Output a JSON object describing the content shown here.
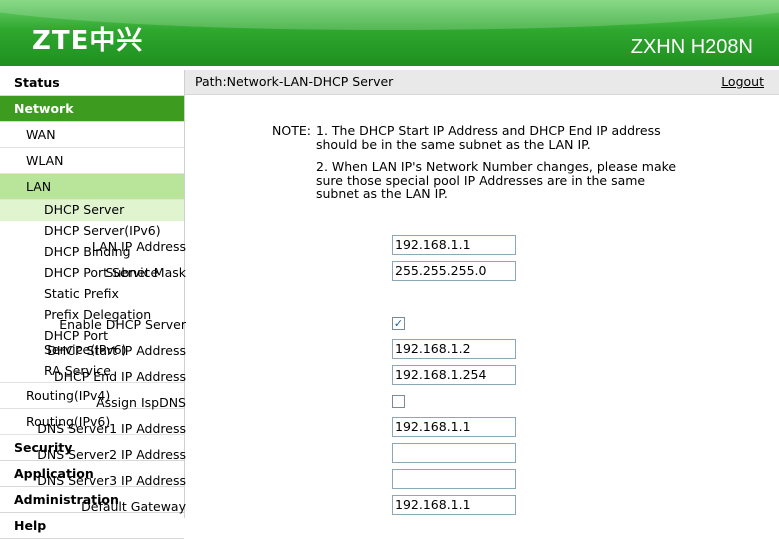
{
  "header": {
    "logo": "ZTE中兴",
    "model": "ZXHN H208N"
  },
  "sidebar": {
    "status": "Status",
    "network": "Network",
    "wan": "WAN",
    "wlan": "WLAN",
    "lan": "LAN",
    "lan_items": [
      "DHCP Server",
      "DHCP Server(IPv6)",
      "DHCP Binding",
      "DHCP Port Service",
      "Static Prefix",
      "Prefix Delegation",
      "DHCP Port Service(IPv6)",
      "RA Service"
    ],
    "routing_ipv4": "Routing(IPv4)",
    "routing_ipv6": "Routing(IPv6)",
    "security": "Security",
    "application": "Application",
    "administration": "Administration",
    "help": "Help"
  },
  "pathbar": {
    "path": "Path:Network-LAN-DHCP Server",
    "logout": "Logout"
  },
  "note": {
    "label": "NOTE:",
    "line1": "1. The DHCP Start IP Address and DHCP End IP address should be in the same subnet as the LAN IP.",
    "line2": "2. When LAN IP's Network Number changes, please make sure those special pool IP Addresses are in the same subnet as the LAN IP."
  },
  "form": {
    "lan_ip": {
      "label": "LAN IP Address",
      "value": "192.168.1.1"
    },
    "subnet": {
      "label": "Subnet Mask",
      "value": "255.255.255.0"
    },
    "enable_dhcp": {
      "label": "Enable DHCP Server",
      "checked": "✓"
    },
    "start_ip": {
      "label": "DHCP Start IP Address",
      "value": "192.168.1.2"
    },
    "end_ip": {
      "label": "DHCP End IP Address",
      "value": "192.168.1.254"
    },
    "assign_isp_dns": {
      "label": "Assign IspDNS",
      "checked": ""
    },
    "dns1": {
      "label": "DNS Server1 IP Address",
      "value": "192.168.1.1"
    },
    "dns2": {
      "label": "DNS Server2 IP Address",
      "value": ""
    },
    "dns3": {
      "label": "DNS Server3 IP Address",
      "value": ""
    },
    "gateway": {
      "label": "Default Gateway",
      "value": "192.168.1.1"
    }
  },
  "colors": {
    "header_green": "#2fa82f",
    "nav_active": "#3d9c1f",
    "sub_active": "#b9e59b",
    "leaf_active": "#e0f4cf"
  }
}
